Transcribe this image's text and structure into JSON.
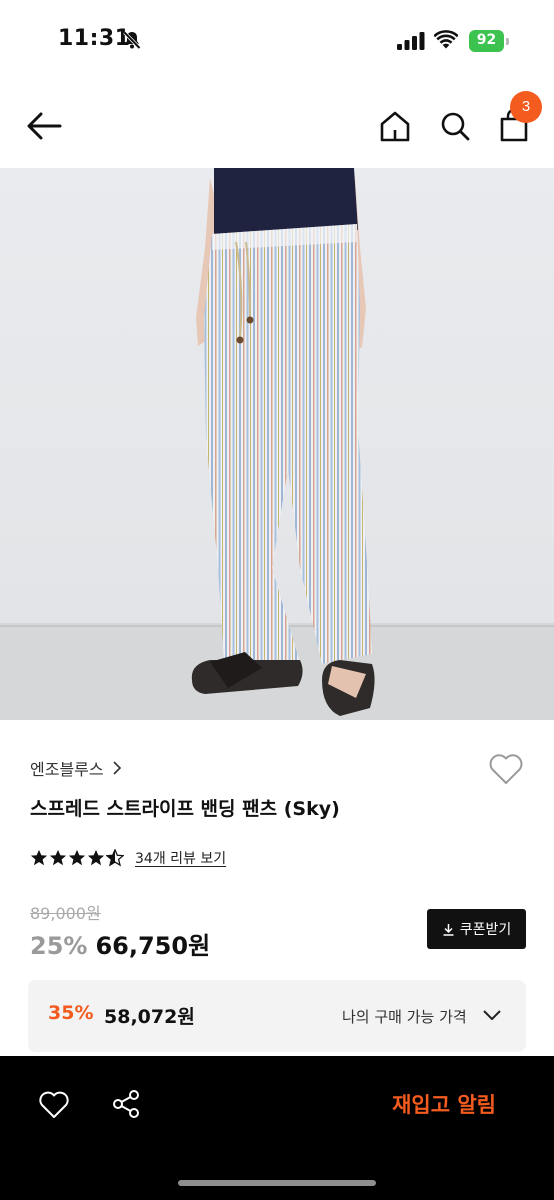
{
  "status_bar": {
    "time": "11:31",
    "battery": "92"
  },
  "nav": {
    "cart_count": "3"
  },
  "product": {
    "brand": "엔조블루스",
    "title": "스프레드 스트라이프 밴딩 팬츠 (Sky)",
    "rating": 4.5,
    "review_link": "34개 리뷰 보기",
    "original_price": "89,000원",
    "discount_rate": "25%",
    "sale_price": "66,750원",
    "coupon_label": "쿠폰받기"
  },
  "my_price": {
    "discount_rate": "35%",
    "price": "58,072원",
    "label": "나의 구매 가능 가격"
  },
  "bottom_bar": {
    "restock_label": "재입고 알림"
  },
  "colors": {
    "accent": "#f45b1f",
    "battery": "#3cc24e",
    "bottom_bar": "#000000"
  },
  "icons": [
    "bell-off-icon",
    "signal-icon",
    "wifi-icon",
    "battery-icon",
    "back-arrow-icon",
    "home-icon",
    "search-icon",
    "shopping-bag-icon",
    "chevron-right-icon",
    "heart-icon",
    "star-icon",
    "download-icon",
    "chevron-down-icon",
    "share-icon"
  ]
}
